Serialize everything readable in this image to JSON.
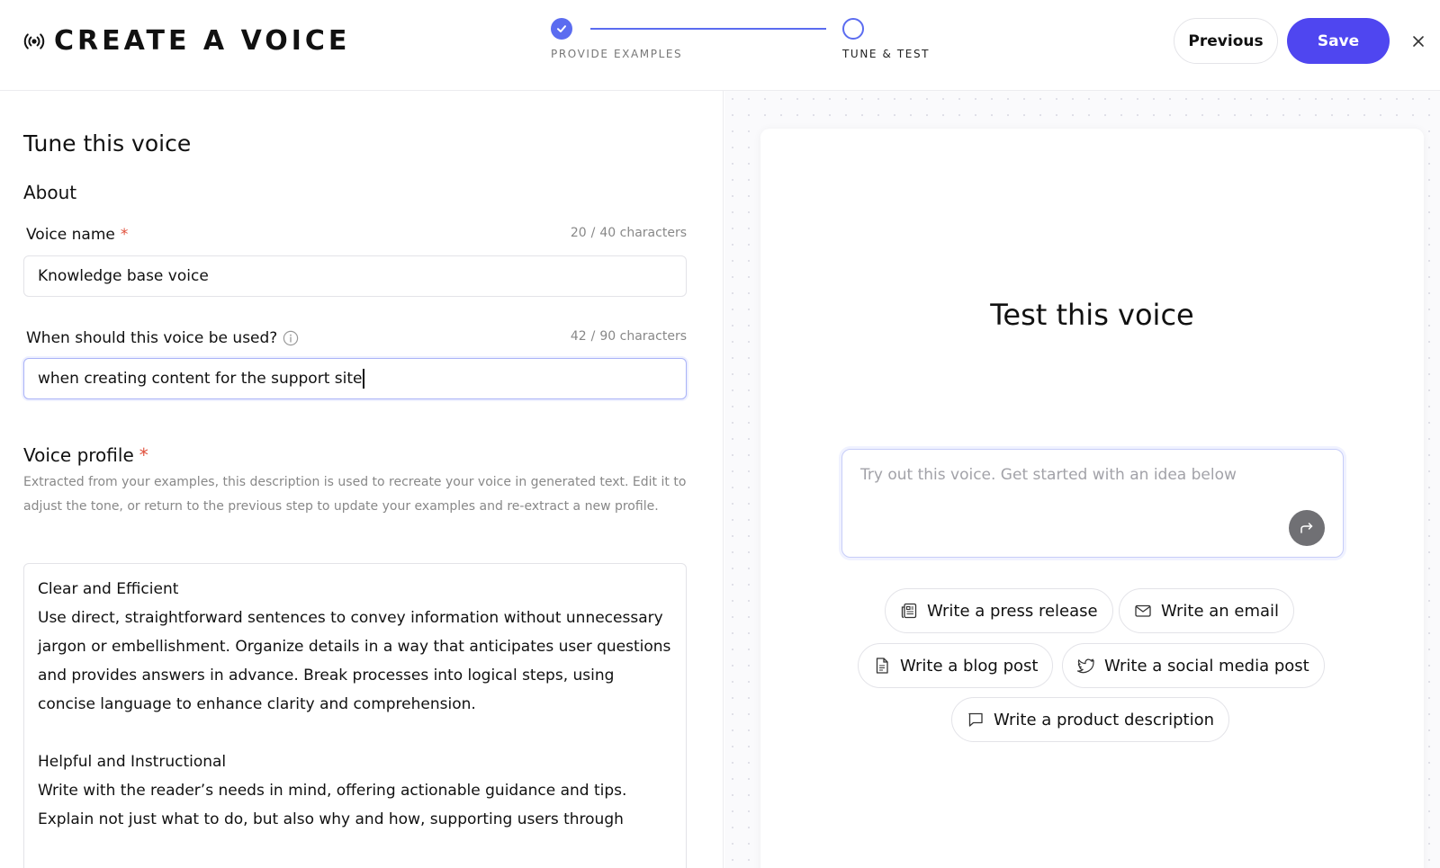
{
  "header": {
    "title": "CREATE A VOICE",
    "brand_icon": "broadcast-icon",
    "steps": [
      {
        "label": "PROVIDE EXAMPLES",
        "state": "complete"
      },
      {
        "label": "TUNE & TEST",
        "state": "current"
      }
    ],
    "previous_label": "Previous",
    "save_label": "Save",
    "close_icon": "close-icon"
  },
  "colors": {
    "accent": "#4f46f0",
    "step": "#5b6cf0",
    "required": "#e0503c"
  },
  "left": {
    "heading": "Tune this voice",
    "about_heading": "About",
    "voice_name": {
      "label": "Voice name",
      "required": "*",
      "count": "20",
      "max": "40 characters",
      "value": "Knowledge base voice"
    },
    "usage": {
      "label": "When should this voice be used?",
      "count": "42",
      "max": "90 characters",
      "value": "when creating content for the support site"
    },
    "profile": {
      "heading": "Voice profile",
      "required": "*",
      "description": "Extracted from your examples, this description is used to recreate your voice in generated text. Edit it to adjust the tone, or return to the previous step to update your examples and re-extract a new profile.",
      "sections": [
        {
          "title": "Clear and Efficient",
          "body": "Use direct, straightforward sentences to convey information without unnecessary jargon or embellishment. Organize details in a way that anticipates user questions and provides answers in advance. Break processes into logical steps, using concise language to enhance clarity and comprehension."
        },
        {
          "title": "Helpful and Instructional",
          "body": "Write with the reader’s needs in mind, offering actionable guidance and tips. Explain not just what to do, but also why and how, supporting users through"
        }
      ]
    }
  },
  "right": {
    "title": "Test this voice",
    "prompt_placeholder": "Try out this voice. Get started with an idea below",
    "send_icon": "send-arrow-icon",
    "suggestions": [
      {
        "label": "Write a press release",
        "icon": "newspaper-icon"
      },
      {
        "label": "Write an email",
        "icon": "mail-icon"
      },
      {
        "label": "Write a blog post",
        "icon": "document-icon"
      },
      {
        "label": "Write a social media post",
        "icon": "twitter-icon"
      },
      {
        "label": "Write a product description",
        "icon": "chat-bubble-icon"
      }
    ]
  }
}
